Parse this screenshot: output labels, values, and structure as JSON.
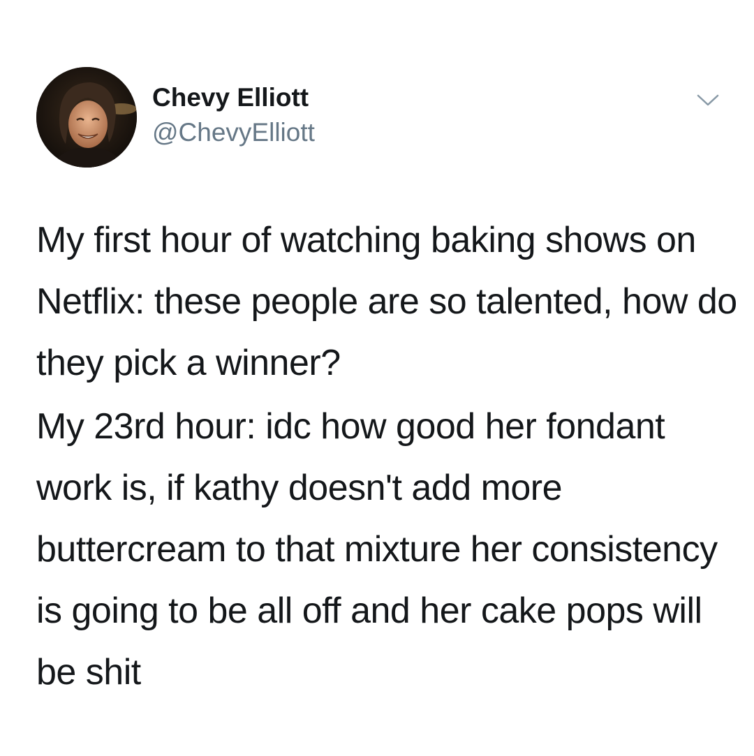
{
  "tweet": {
    "author": {
      "display_name": "Chevy Elliott",
      "handle": "@ChevyElliott",
      "avatar_icon": "user-avatar-photo"
    },
    "menu_icon": "chevron-down-icon",
    "body": {
      "paragraph_1": "My first hour of watching baking shows on Netflix: these people are so talented, how do they pick a winner?",
      "paragraph_2": "My 23rd hour: idc how good her fondant work is, if kathy doesn't add more buttercream to that mixture her consistency is going to be all off and her cake pops will be shit"
    }
  },
  "colors": {
    "text": "#14171a",
    "secondary_text": "#657786",
    "chevron": "#8899a6",
    "background": "#ffffff"
  }
}
